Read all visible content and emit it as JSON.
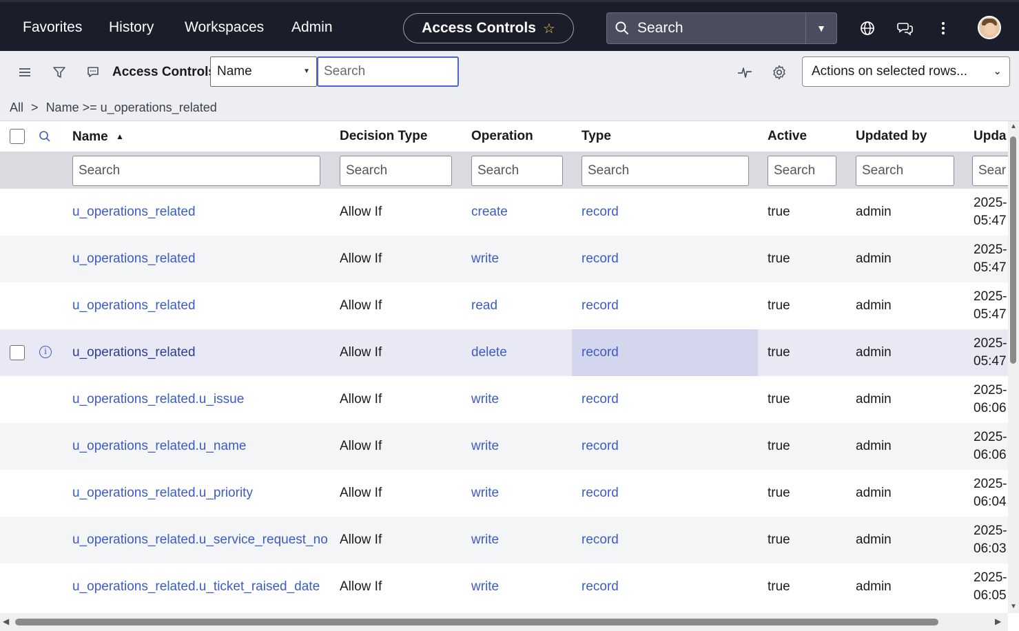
{
  "topnav": {
    "menu": [
      "Favorites",
      "History",
      "Workspaces",
      "Admin"
    ],
    "current_page": "Access Controls",
    "search_placeholder": "Search",
    "icons": [
      "globe-icon",
      "chat-icon",
      "more-vert-icon"
    ]
  },
  "toolbar": {
    "title": "Access Controls",
    "field_select": "Name",
    "search_placeholder": "Search",
    "actions_select": "Actions on selected rows..."
  },
  "breadcrumb": {
    "all": "All",
    "separator": ">",
    "condition": "Name >= u_operations_related"
  },
  "table": {
    "columns": [
      "Name",
      "Decision Type",
      "Operation",
      "Type",
      "Active",
      "Updated by",
      "Upda"
    ],
    "sort_indicator": "▲",
    "filter_placeholder": "Search",
    "filter_placeholder_cut": "Sear",
    "rows": [
      {
        "name": "u_operations_related",
        "decision": "Allow If",
        "operation": "create",
        "type": "record",
        "active": "true",
        "updated_by": "admin",
        "date1": "2025-",
        "date2": "05:47"
      },
      {
        "name": "u_operations_related",
        "decision": "Allow If",
        "operation": "write",
        "type": "record",
        "active": "true",
        "updated_by": "admin",
        "date1": "2025-",
        "date2": "05:47"
      },
      {
        "name": "u_operations_related",
        "decision": "Allow If",
        "operation": "read",
        "type": "record",
        "active": "true",
        "updated_by": "admin",
        "date1": "2025-",
        "date2": "05:47"
      },
      {
        "name": "u_operations_related",
        "decision": "Allow If",
        "operation": "delete",
        "type": "record",
        "active": "true",
        "updated_by": "admin",
        "date1": "2025-",
        "date2": "05:47"
      },
      {
        "name": "u_operations_related.u_issue",
        "decision": "Allow If",
        "operation": "write",
        "type": "record",
        "active": "true",
        "updated_by": "admin",
        "date1": "2025-",
        "date2": "06:06"
      },
      {
        "name": "u_operations_related.u_name",
        "decision": "Allow If",
        "operation": "write",
        "type": "record",
        "active": "true",
        "updated_by": "admin",
        "date1": "2025-",
        "date2": "06:06"
      },
      {
        "name": "u_operations_related.u_priority",
        "decision": "Allow If",
        "operation": "write",
        "type": "record",
        "active": "true",
        "updated_by": "admin",
        "date1": "2025-",
        "date2": "06:04"
      },
      {
        "name": "u_operations_related.u_service_request_no",
        "decision": "Allow If",
        "operation": "write",
        "type": "record",
        "active": "true",
        "updated_by": "admin",
        "date1": "2025-",
        "date2": "06:03"
      },
      {
        "name": "u_operations_related.u_ticket_raised_date",
        "decision": "Allow If",
        "operation": "write",
        "type": "record",
        "active": "true",
        "updated_by": "admin",
        "date1": "2025-",
        "date2": "06:05"
      }
    ]
  },
  "colors": {
    "nav_bg": "#1b1d2a",
    "link": "#3b5bc7",
    "focus_border": "#4c63d2",
    "hover_row": "#e8e9f5",
    "selected_cell": "#d4d6ee"
  }
}
